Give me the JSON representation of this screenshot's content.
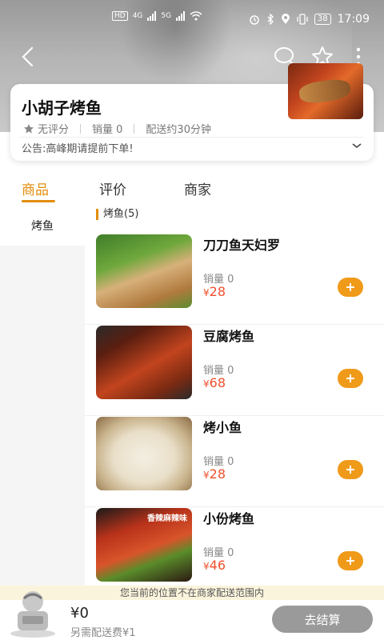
{
  "status_bar": {
    "left_badges": [
      "HD",
      "HD"
    ],
    "network_1": "4G",
    "network_2": "5G",
    "battery": "38",
    "time": "17:09"
  },
  "nav": {
    "back_icon": "chevron-left-icon",
    "search_icon": "search-icon",
    "favorite_icon": "star-outline-icon",
    "more_icon": "more-vertical-icon"
  },
  "store": {
    "name": "小胡子烤鱼",
    "rating": "无评分",
    "sales": "销量 0",
    "delivery_time": "配送约30分钟",
    "notice": "公告:高峰期请提前下单!"
  },
  "tabs": [
    {
      "label": "商品",
      "active": true
    },
    {
      "label": "评价",
      "active": false
    },
    {
      "label": "商家",
      "active": false
    }
  ],
  "categories": [
    {
      "label": "烤鱼",
      "active": true
    }
  ],
  "section": {
    "title": "烤鱼(5)"
  },
  "products": [
    {
      "name": "刀刀鱼天妇罗",
      "sales": "销量 0",
      "currency": "¥",
      "price": "28"
    },
    {
      "name": "豆腐烤鱼",
      "sales": "销量 0",
      "currency": "¥",
      "price": "68"
    },
    {
      "name": "烤小鱼",
      "sales": "销量 0",
      "currency": "¥",
      "price": "28"
    },
    {
      "name": "小份烤鱼",
      "sales": "销量 0",
      "currency": "¥",
      "price": "46",
      "image_label": "香辣麻辣味"
    }
  ],
  "cart": {
    "notice": "您当前的位置不在商家配送范围内",
    "total": "¥0",
    "delivery_fee": "另需配送费¥1",
    "checkout_label": "去结算"
  },
  "colors": {
    "accent": "#e38d0b",
    "price": "#f0502e",
    "add_button": "#f09a1a",
    "checkout_disabled": "#9a9a9a"
  }
}
